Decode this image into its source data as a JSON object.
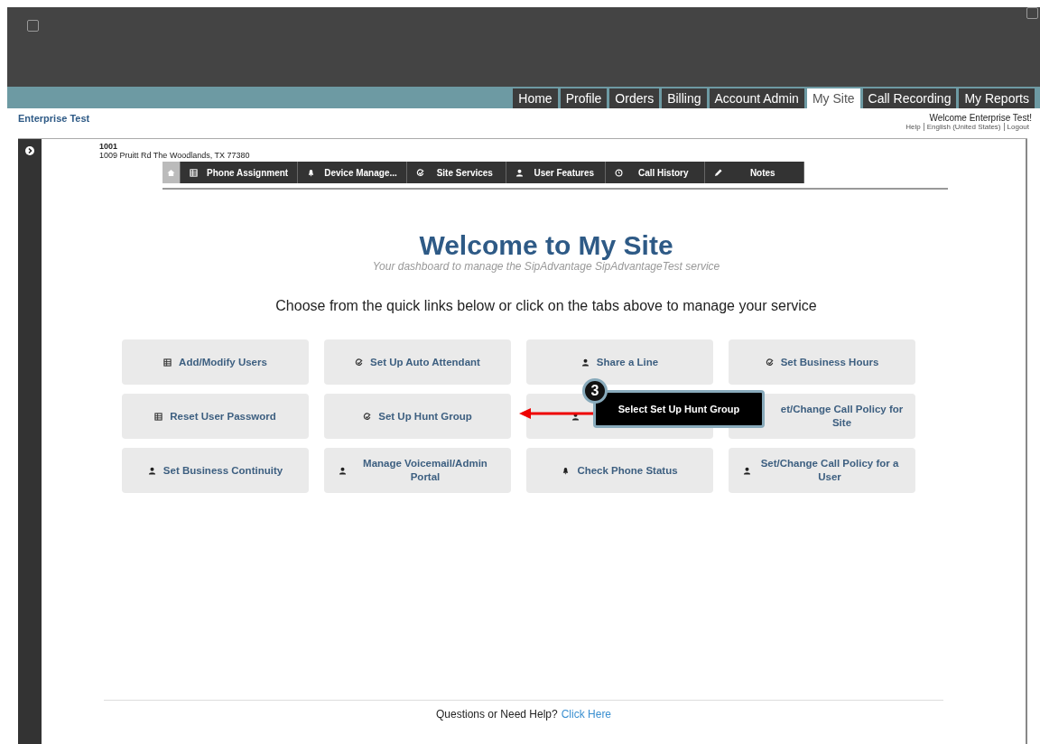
{
  "nav_tabs": [
    {
      "label": "Home",
      "selected": false
    },
    {
      "label": "Profile",
      "selected": false
    },
    {
      "label": "Orders",
      "selected": false
    },
    {
      "label": "Billing",
      "selected": false
    },
    {
      "label": "Account Admin",
      "selected": false
    },
    {
      "label": "My Site",
      "selected": true
    },
    {
      "label": "Call Recording",
      "selected": false
    },
    {
      "label": "My Reports",
      "selected": false
    }
  ],
  "account_name": "Enterprise Test",
  "welcome": "Welcome Enterprise Test!",
  "user_links": [
    "Help",
    "English (United States)",
    "Logout"
  ],
  "site": {
    "number": "1001",
    "address": "1009 Pruitt Rd The Woodlands, TX 77380"
  },
  "site_tabs": [
    {
      "kind": "home",
      "selected": true
    },
    {
      "kind": "grid",
      "label": "Phone Assignment",
      "selected": false
    },
    {
      "kind": "bell",
      "label": "Device Manage...",
      "selected": false
    },
    {
      "kind": "check",
      "label": "Site Services",
      "selected": false
    },
    {
      "kind": "person",
      "label": "User Features",
      "selected": false
    },
    {
      "kind": "clock",
      "label": "Call History",
      "selected": false
    },
    {
      "kind": "pencil",
      "label": "Notes",
      "selected": false
    }
  ],
  "title": "Welcome to My Site",
  "subtitle": "Your dashboard to manage the SipAdvantage SipAdvantageTest service",
  "instructions": "Choose from the quick links below or click on the tabs above to manage your service",
  "quick_links": [
    {
      "kind": "grid",
      "label": "Add/Modify Users"
    },
    {
      "kind": "check",
      "label": "Set Up Auto Attendant"
    },
    {
      "kind": "person",
      "label": "Share a Line"
    },
    {
      "kind": "check",
      "label": "Set Business Hours"
    },
    {
      "kind": "grid",
      "label": "Reset User Password"
    },
    {
      "kind": "check",
      "label": "Set Up Hunt Group"
    },
    {
      "kind": "person"
    },
    {
      "kind": "none",
      "label": "et/Change Call Policy for Site"
    },
    {
      "kind": "person",
      "label": "Set Business Continuity"
    },
    {
      "kind": "person",
      "label": "Manage Voicemail/Admin Portal"
    },
    {
      "kind": "bell",
      "label": "Check Phone Status"
    },
    {
      "kind": "person",
      "label": "Set/Change Call Policy for a User"
    }
  ],
  "callout": {
    "step": "3",
    "text": "Select Set Up Hunt Group"
  },
  "footer": {
    "text": "Questions or Need Help?",
    "link": "Click Here"
  }
}
